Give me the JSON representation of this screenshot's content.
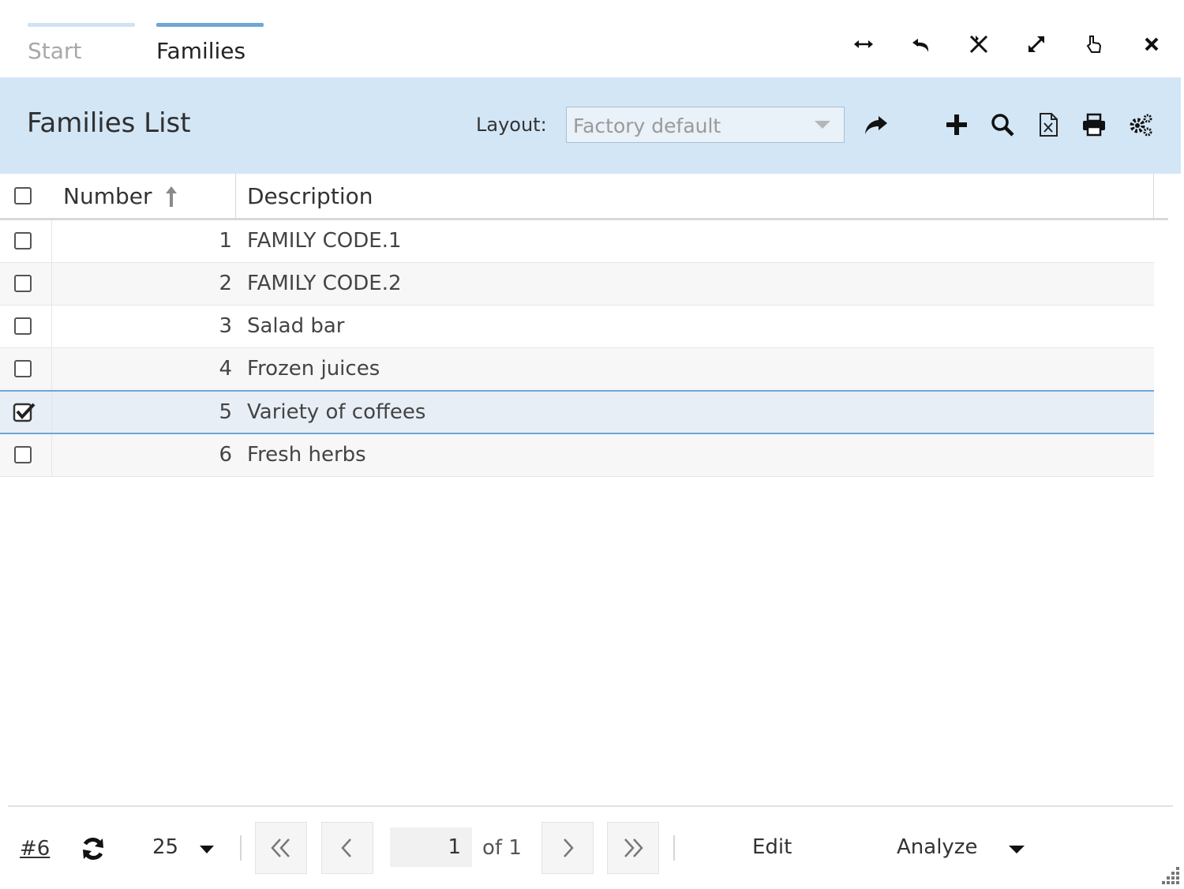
{
  "tabs": [
    {
      "label": "Start"
    },
    {
      "label": "Families"
    }
  ],
  "window_controls": [
    "resize-horizontal-icon",
    "undo-icon",
    "collapse-icon",
    "expand-icon",
    "pointer-icon",
    "close-icon"
  ],
  "header": {
    "title": "Families List",
    "layout_label": "Layout:",
    "layout_value": "Factory default",
    "actions": [
      "share-icon",
      "add-icon",
      "search-icon",
      "excel-export-icon",
      "print-icon",
      "settings-icon"
    ]
  },
  "grid": {
    "columns": [
      "Number",
      "Description"
    ],
    "sort": "ascending",
    "rows": [
      {
        "number": "1",
        "description": "FAMILY CODE.1",
        "checked": false
      },
      {
        "number": "2",
        "description": "FAMILY CODE.2",
        "checked": false
      },
      {
        "number": "3",
        "description": "Salad bar",
        "checked": false
      },
      {
        "number": "4",
        "description": "Frozen juices",
        "checked": false
      },
      {
        "number": "5",
        "description": "Variety of coffees",
        "checked": true
      },
      {
        "number": "6",
        "description": "Fresh herbs",
        "checked": false
      }
    ]
  },
  "footer": {
    "record_count": "#6",
    "page_size": "25",
    "page": "1",
    "of_pages": "of 1",
    "edit_label": "Edit",
    "analyze_label": "Analyze"
  },
  "colors": {
    "accent": "#6fa6d6",
    "header_bg": "#d3e6f6",
    "selected_row": "#e8eef5"
  }
}
